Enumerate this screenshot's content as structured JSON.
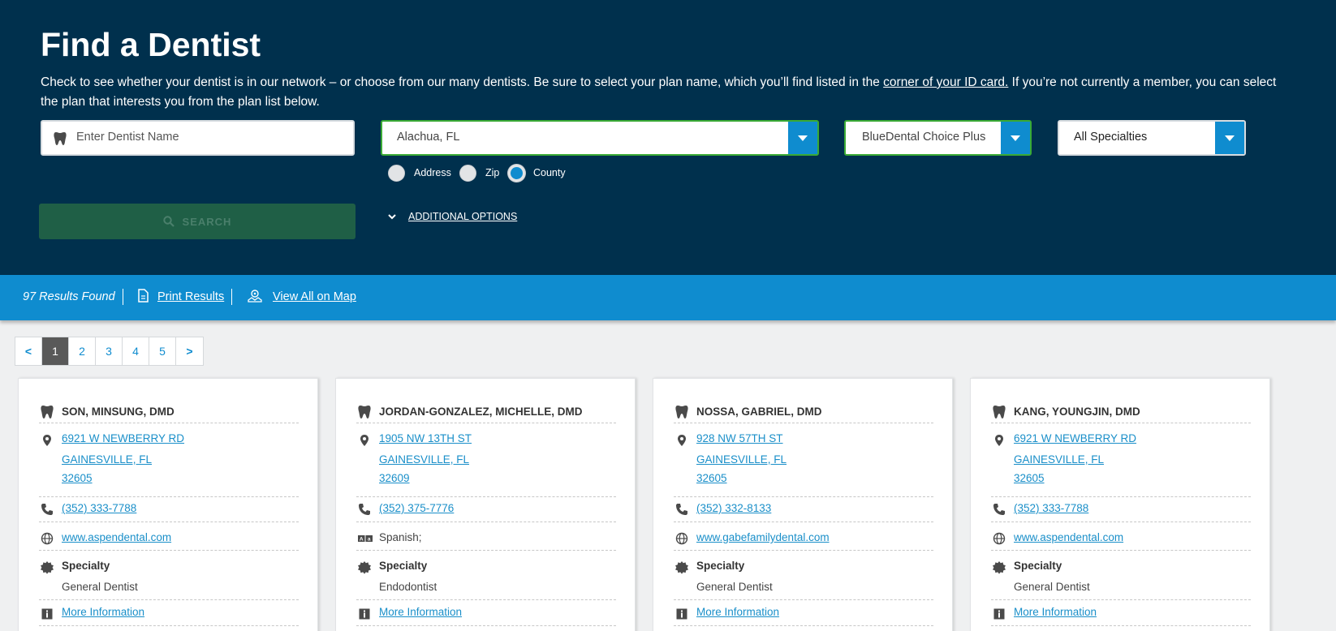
{
  "header": {
    "title": "Find a Dentist",
    "desc_part1": "Check to see whether your dentist is in our network – or choose from our many dentists. Be sure to select your plan name, which you’ll find listed in the ",
    "desc_link": "corner of your ID card.",
    "desc_part2": " If you’re not currently a member, you can select the plan that interests you from the plan list below."
  },
  "search": {
    "name_placeholder": "Enter Dentist Name",
    "location_value": "Alachua, FL",
    "plan_value": "BlueDental Choice Plus",
    "specialty_value": "All Specialties",
    "radio_options": [
      "Address",
      "Zip",
      "County"
    ],
    "radio_selected": "County",
    "search_label": "SEARCH",
    "additional_options_label": "ADDITIONAL OPTIONS"
  },
  "results_bar": {
    "count_text": "97 Results Found",
    "print_label": "Print Results",
    "map_label": "View All on Map"
  },
  "pagination": {
    "prev": "<",
    "pages": [
      "1",
      "2",
      "3",
      "4",
      "5"
    ],
    "active": "1",
    "next": ">"
  },
  "cards": [
    {
      "name": "SON, MINSUNG, DMD",
      "address_line1": "6921 W NEWBERRY RD",
      "address_line2": "GAINESVILLE, FL",
      "address_zip": "32605",
      "phone": "(352) 333-7788",
      "extra_type": "website",
      "extra": "www.aspendental.com",
      "specialty_label": "Specialty",
      "specialty": "General Dentist",
      "more_info": "More Information"
    },
    {
      "name": "JORDAN-GONZALEZ, MICHELLE, DMD",
      "address_line1": "1905 NW 13TH ST",
      "address_line2": "GAINESVILLE, FL",
      "address_zip": "32609",
      "phone": "(352) 375-7776",
      "extra_type": "language",
      "extra": "Spanish;",
      "specialty_label": "Specialty",
      "specialty": "Endodontist",
      "more_info": "More Information"
    },
    {
      "name": "NOSSA, GABRIEL, DMD",
      "address_line1": "928 NW 57TH ST",
      "address_line2": "GAINESVILLE, FL",
      "address_zip": "32605",
      "phone": "(352) 332-8133",
      "extra_type": "website",
      "extra": "www.gabefamilydental.com",
      "specialty_label": "Specialty",
      "specialty": "General Dentist",
      "more_info": "More Information"
    },
    {
      "name": "KANG, YOUNGJIN, DMD",
      "address_line1": "6921 W NEWBERRY RD",
      "address_line2": "GAINESVILLE, FL",
      "address_zip": "32605",
      "phone": "(352) 333-7788",
      "extra_type": "website",
      "extra": "www.aspendental.com",
      "specialty_label": "Specialty",
      "specialty": "General Dentist",
      "more_info": "More Information"
    }
  ],
  "colors": {
    "header_bg": "#00304d",
    "accent_blue": "#0f8ccf",
    "valid_green": "#3aaa35",
    "search_button": "#1f5f46",
    "link": "#1a8fc9"
  },
  "icons": [
    "tooth-icon",
    "map-pin-icon",
    "phone-icon",
    "globe-icon",
    "language-icon",
    "badge-icon",
    "info-icon",
    "document-icon",
    "map-icon",
    "search-icon",
    "chevron-down-icon"
  ]
}
